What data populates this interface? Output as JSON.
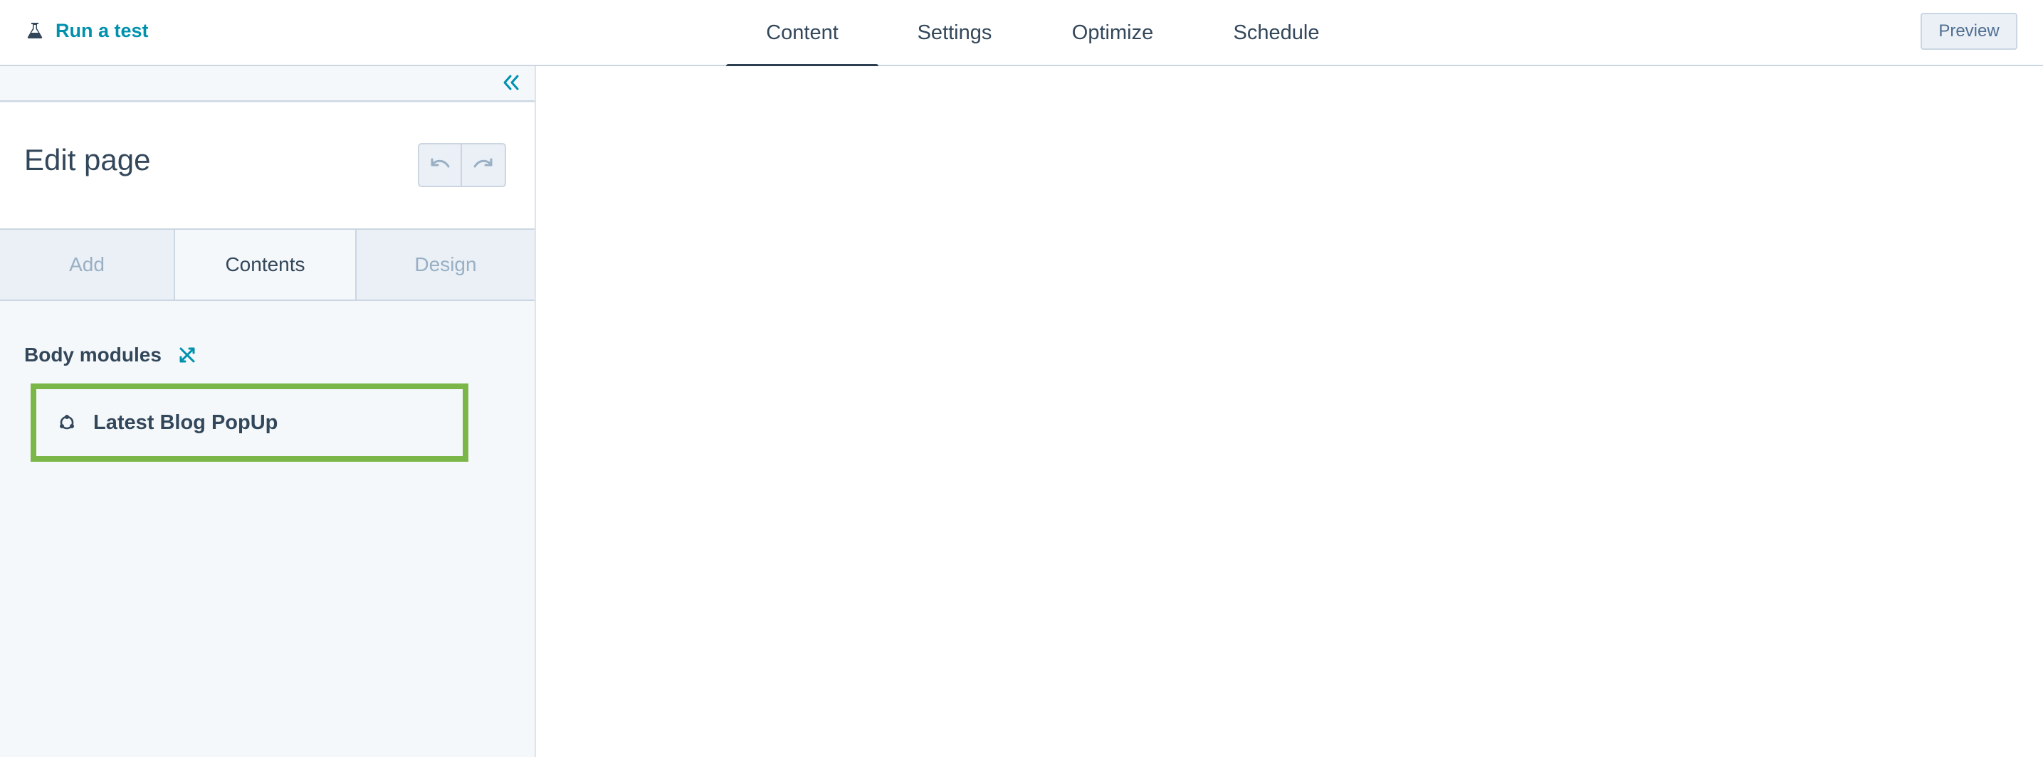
{
  "header": {
    "run_test_label": "Run a test",
    "tabs": [
      {
        "label": "Content",
        "active": true
      },
      {
        "label": "Settings",
        "active": false
      },
      {
        "label": "Optimize",
        "active": false
      },
      {
        "label": "Schedule",
        "active": false
      }
    ],
    "preview_label": "Preview"
  },
  "sidebar": {
    "title": "Edit page",
    "tabs": [
      {
        "label": "Add",
        "active": false
      },
      {
        "label": "Contents",
        "active": true
      },
      {
        "label": "Design",
        "active": false
      }
    ],
    "section_label": "Body modules",
    "modules": [
      {
        "label": "Latest Blog PopUp",
        "icon": "module-icon",
        "highlighted": true
      }
    ]
  },
  "icons": {
    "run_test": "flask-icon",
    "collapse": "double-chevron-left-icon",
    "undo": "undo-icon",
    "redo": "redo-icon",
    "section_action": "cross-arrows-icon",
    "module": "module-icon"
  },
  "colors": {
    "accent": "#0091ae",
    "text": "#33475b",
    "highlight": "#7ab648",
    "muted": "#99afc4"
  }
}
